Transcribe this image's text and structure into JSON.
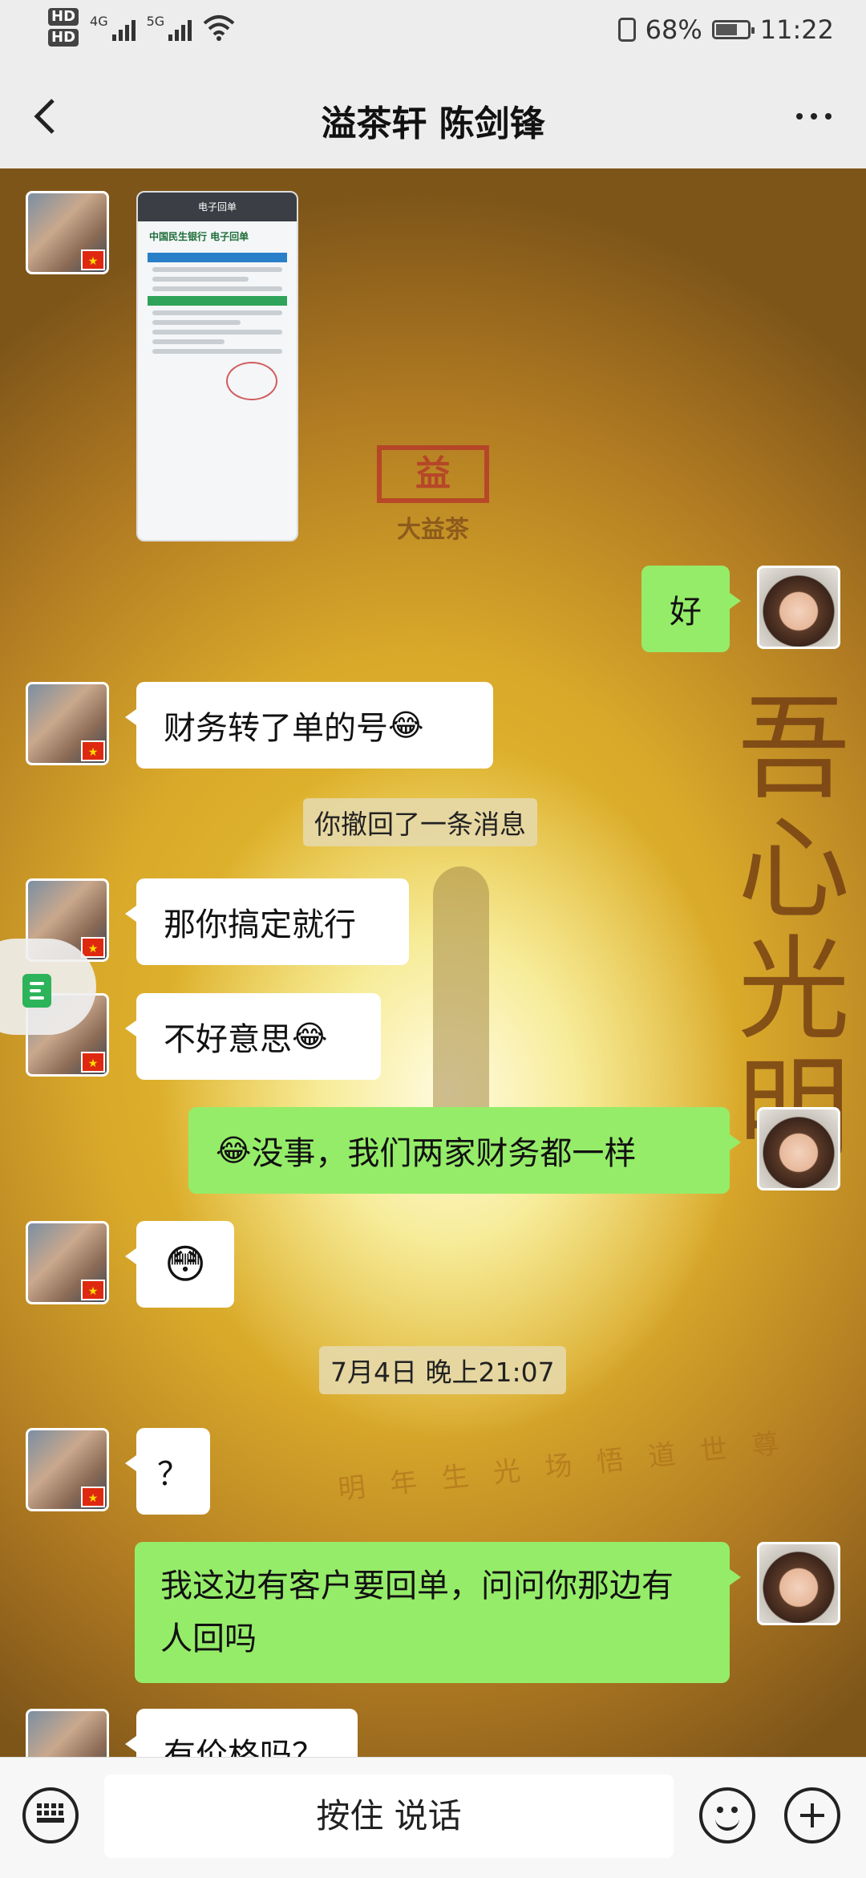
{
  "status_bar": {
    "hd1": "HD",
    "hd2": "HD",
    "net1": "4G",
    "net2": "5G",
    "battery_percent": "68%",
    "battery_level": 0.68,
    "time": "11:22"
  },
  "header": {
    "title": "溢茶轩  陈剑锋",
    "back_icon": "chevron-left-icon",
    "more_icon": "more-dots-icon"
  },
  "background": {
    "brand_text": "大益茶",
    "calligraphy": "吾心光明",
    "verse": "明 年 生 光 场 悟 道 世 尊"
  },
  "image_message": {
    "header": "电子回单",
    "bank": "中国民生银行 电子回单"
  },
  "messages": [
    {
      "side": "right",
      "text": "好"
    },
    {
      "side": "left",
      "text": "财务转了单的号",
      "emoji": "😂"
    },
    {
      "side": "left",
      "text": "那你搞定就行"
    },
    {
      "side": "left",
      "text": "不好意思",
      "emoji": "😂"
    },
    {
      "side": "right",
      "text": "没事，我们两家财务都一样",
      "emoji": "😂"
    },
    {
      "side": "left",
      "emoji": "😳"
    },
    {
      "side": "left",
      "text": "？"
    },
    {
      "side": "right",
      "text": "我这边有客户要回单，问问你那边有人回吗"
    },
    {
      "side": "left",
      "text": "有价格吗？"
    }
  ],
  "system": {
    "recalled": "你撤回了一条消息",
    "timestamp": "7月4日 晚上21:07"
  },
  "input_bar": {
    "hold_to_talk": "按住 说话",
    "keyboard_icon": "keyboard-icon",
    "emoji_icon": "emoji-smile-icon",
    "add_icon": "plus-circle-icon"
  },
  "colors": {
    "self_bubble": "#95ec69",
    "other_bubble": "#ffffff",
    "bar_bg": "#ededed"
  }
}
